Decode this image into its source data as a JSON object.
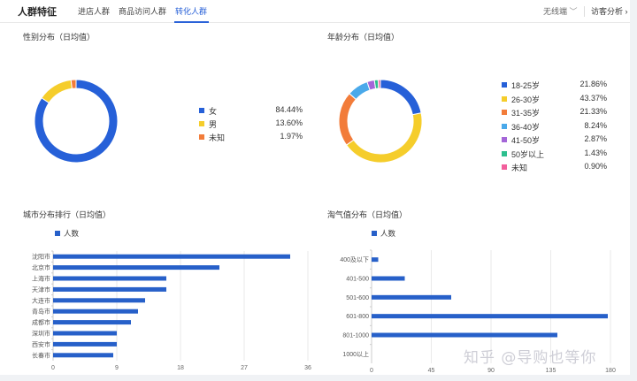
{
  "header": {
    "title": "人群特征",
    "tabs": [
      {
        "label": "进店人群"
      },
      {
        "label": "商品访问人群"
      },
      {
        "label": "转化人群"
      }
    ],
    "filter_label": "无线端",
    "analysis_label": "访客分析"
  },
  "colors": {
    "accent": "#2a62d8",
    "bar": "#2760c9",
    "gender": [
      "#2660d8",
      "#f5cd2b",
      "#f27c3a"
    ],
    "age": [
      "#2660d8",
      "#f5cd2b",
      "#f27c3a",
      "#4aa9ea",
      "#a466d8",
      "#2dbf8e",
      "#f25f9c"
    ]
  },
  "gender": {
    "title": "性别分布（日均值）",
    "chart_data": {
      "type": "pie",
      "labels": [
        "女",
        "男",
        "未知"
      ],
      "values": [
        84.44,
        13.6,
        1.97
      ],
      "display": [
        "84.44%",
        "13.60%",
        "1.97%"
      ]
    }
  },
  "age": {
    "title": "年龄分布（日均值）",
    "chart_data": {
      "type": "pie",
      "labels": [
        "18-25岁",
        "26-30岁",
        "31-35岁",
        "36-40岁",
        "41-50岁",
        "50岁以上",
        "未知"
      ],
      "values": [
        21.86,
        43.37,
        21.33,
        8.24,
        2.87,
        1.43,
        0.9
      ],
      "display": [
        "21.86%",
        "43.37%",
        "21.33%",
        "8.24%",
        "2.87%",
        "1.43%",
        "0.90%"
      ]
    }
  },
  "city": {
    "title": "城市分布排行（日均值）",
    "chart_data": {
      "type": "bar",
      "series_name": "人数",
      "categories": [
        "沈阳市",
        "北京市",
        "上海市",
        "天津市",
        "大连市",
        "青岛市",
        "成都市",
        "深圳市",
        "西安市",
        "长春市"
      ],
      "values": [
        33.5,
        23.5,
        16,
        16,
        13,
        12,
        11,
        9,
        9,
        8.5
      ],
      "ticks": [
        0,
        9,
        18,
        27,
        36
      ],
      "xlim": [
        0,
        36
      ]
    }
  },
  "naughty": {
    "title": "淘气值分布（日均值）",
    "chart_data": {
      "type": "bar",
      "series_name": "人数",
      "categories": [
        "400及以下",
        "401-500",
        "501-600",
        "601-800",
        "801-1000",
        "1000以上"
      ],
      "values": [
        5,
        25,
        60,
        178,
        140,
        0
      ],
      "ticks": [
        0,
        45,
        90,
        135,
        180
      ],
      "xlim": [
        0,
        180
      ]
    }
  },
  "watermark": "知乎 @导购也等你"
}
